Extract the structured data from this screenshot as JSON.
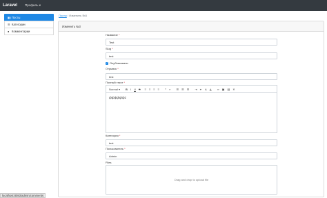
{
  "navbar": {
    "brand": "Laravel",
    "profile_menu": "Профиль"
  },
  "sidebar": {
    "items": [
      {
        "icon": "book-icon",
        "label": "Посты",
        "active": true
      },
      {
        "icon": "list-icon",
        "label": "Категории",
        "active": false
      },
      {
        "icon": "user-icon",
        "label": "Комментарии",
        "active": false
      }
    ]
  },
  "breadcrumb": {
    "parent": "Посты",
    "separator": "/",
    "current": "Изменить №3"
  },
  "card": {
    "header": "Изменить №3"
  },
  "form": {
    "title_label": "Название",
    "title_value": "Test",
    "slug_label": "Slug",
    "slug_value": "test",
    "published_label": "Опубликовано",
    "excerpt_label": "Отрывок",
    "excerpt_value": "test",
    "content_label": "Полный текст",
    "editor_heading": "Normal",
    "editor_text": "фффффф1",
    "category_label": "Категория",
    "category_value": "test",
    "user_label": "Пользователь",
    "user_value": "Admin",
    "files_label": "Files",
    "dropzone_text": "Drag and drop to upload file",
    "required_mark": "*"
  },
  "status_url": "localhost:8083/admin/comments"
}
